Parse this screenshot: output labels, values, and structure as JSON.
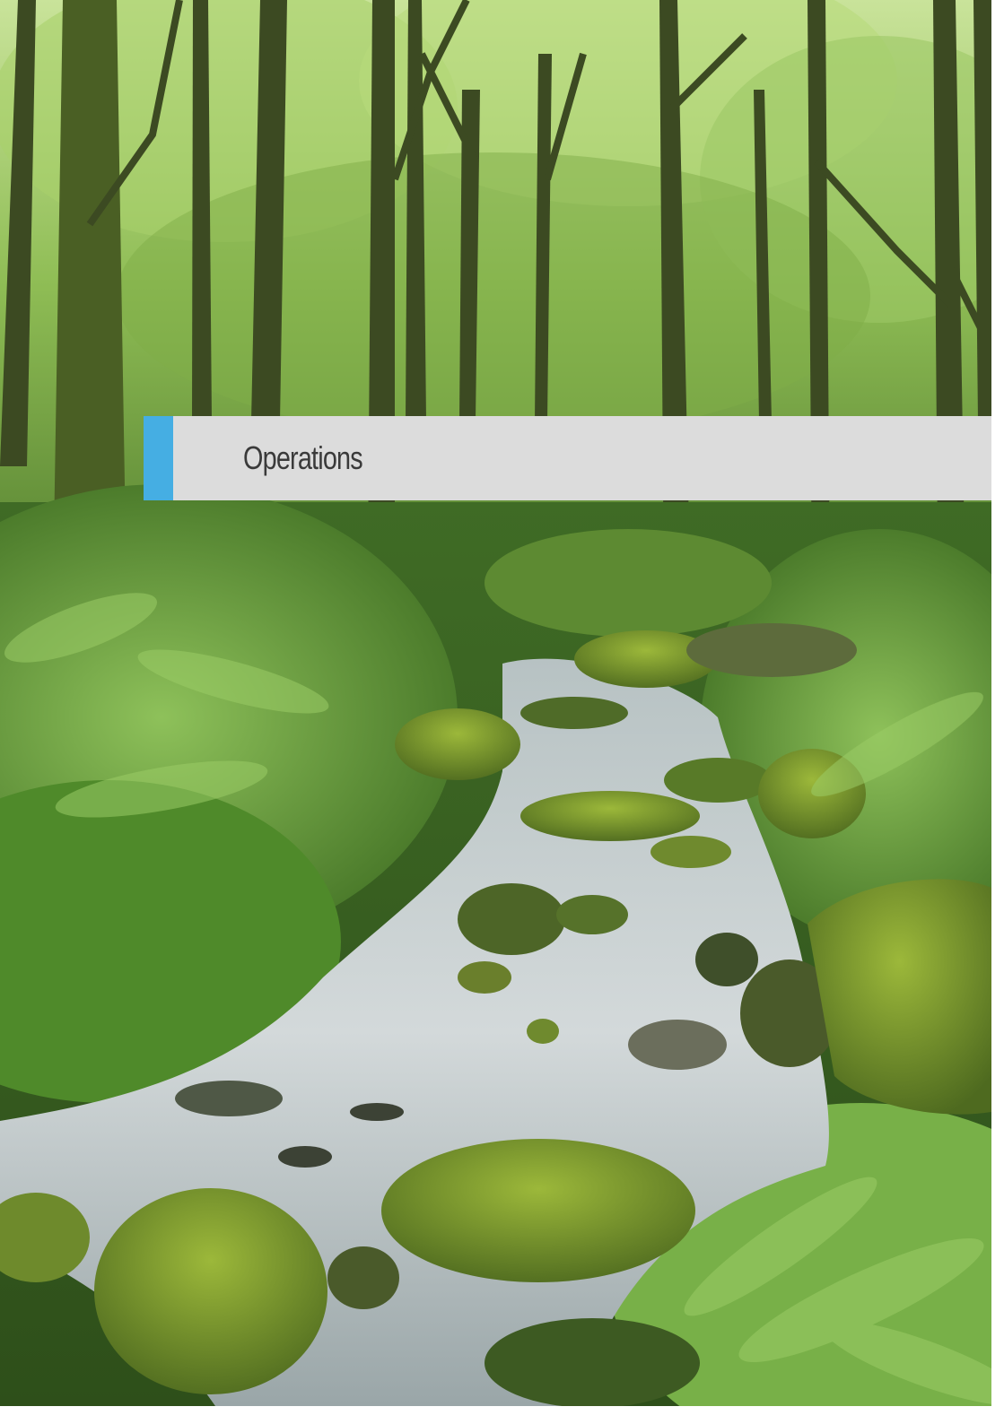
{
  "section": {
    "title": "Operations"
  },
  "colors": {
    "banner_background": "#dcdcdc",
    "accent": "#45aee3",
    "title_text": "#3a3a3a"
  }
}
